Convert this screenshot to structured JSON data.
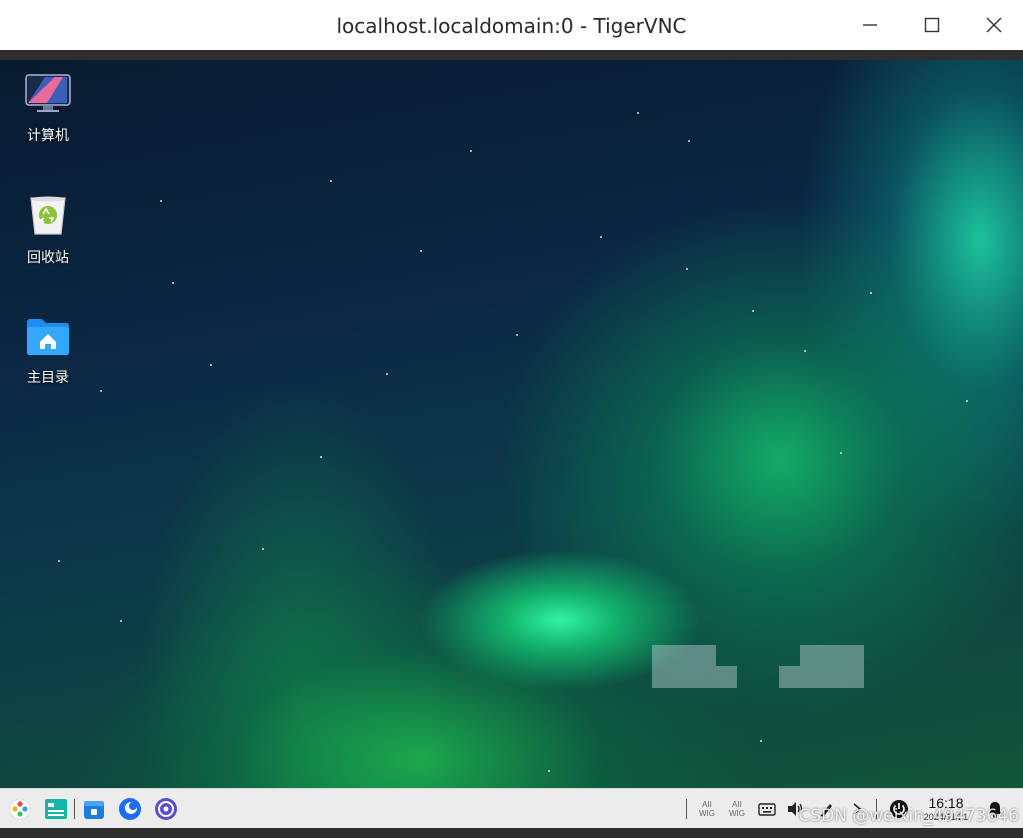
{
  "window": {
    "title": "localhost.localdomain:0 - TigerVNC",
    "controls": [
      "minimize-icon",
      "maximize-icon",
      "close-icon"
    ]
  },
  "desktop": {
    "icons": [
      {
        "label": "计算机",
        "icon": "computer-icon"
      },
      {
        "label": "回收站",
        "icon": "trash-icon"
      },
      {
        "label": "主目录",
        "icon": "home-folder-icon"
      }
    ]
  },
  "taskbar": {
    "apps": [
      "start-menu-icon",
      "multitask-view-icon",
      "file-manager-icon",
      "browser-icon",
      "settings-icon"
    ],
    "tray": {
      "net1": "AII\nWIG",
      "net2": "AII\nWIG",
      "icons": [
        "keyboard-icon",
        "volume-icon",
        "pen-icon",
        "chevron-right-icon",
        "power-icon",
        "bell-icon"
      ]
    },
    "clock": {
      "time": "16:18",
      "date": "2024/11/21"
    }
  },
  "overlay": {
    "csdn_watermark": "CSDN @weixin_49473646"
  },
  "colors": {
    "taskbar": "#ececec",
    "titlebar": "#ffffff",
    "folder_blue": "#1e8ff0"
  }
}
